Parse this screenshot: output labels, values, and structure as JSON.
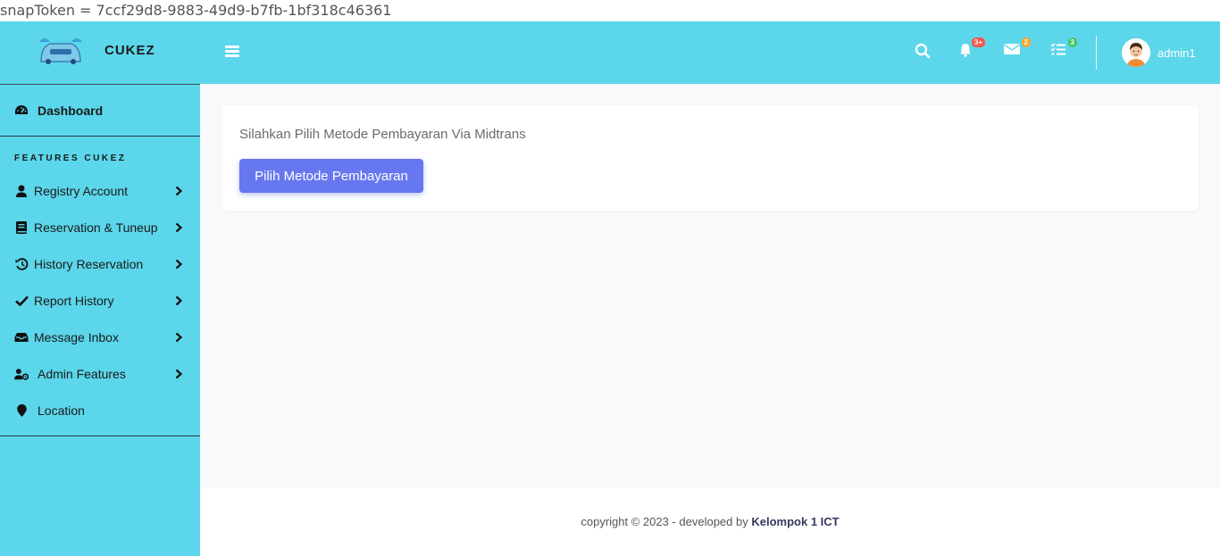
{
  "snap_token_line": "snapToken = 7ccf29d8-9883-49d9-b7fb-1bf318c46361",
  "brand": {
    "name": "CUKEZ",
    "logo_icon": "car-logo-icon"
  },
  "topbar": {
    "icons": [
      {
        "name": "search-icon"
      },
      {
        "name": "bell-icon",
        "badge": "3+",
        "badge_color": "#fc544b"
      },
      {
        "name": "envelope-icon",
        "badge": "2",
        "badge_color": "#ffa426"
      },
      {
        "name": "tasks-icon",
        "badge": "3",
        "badge_color": "#47c363"
      }
    ],
    "user": {
      "name": "admin1"
    }
  },
  "sidebar": {
    "dashboard": "Dashboard",
    "section_heading": "FEATURES CUKEZ",
    "items": [
      {
        "label": "Registry Account",
        "icon": "user-icon"
      },
      {
        "label": "Reservation & Tuneup",
        "icon": "book-icon"
      },
      {
        "label": "History Reservation",
        "icon": "history-icon"
      },
      {
        "label": "Report History",
        "icon": "check-icon"
      },
      {
        "label": "Message Inbox",
        "icon": "inbox-icon"
      },
      {
        "label": "Admin Features",
        "icon": "user-cog-icon"
      },
      {
        "label": "Location",
        "icon": "location-pin-icon"
      }
    ]
  },
  "main": {
    "instruction": "Silahkan Pilih Metode Pembayaran Via Midtrans",
    "pay_button": "Pilih Metode Pembayaran"
  },
  "footer": {
    "text": "copyright © 2023 - developed by ",
    "author": "Kelompok 1 ICT"
  },
  "colors": {
    "sidebar_bg": "#5bd6ea",
    "topbar_bg": "#5bd6ea",
    "primary_button": "#6777ef",
    "content_bg": "#f8f9fa"
  }
}
